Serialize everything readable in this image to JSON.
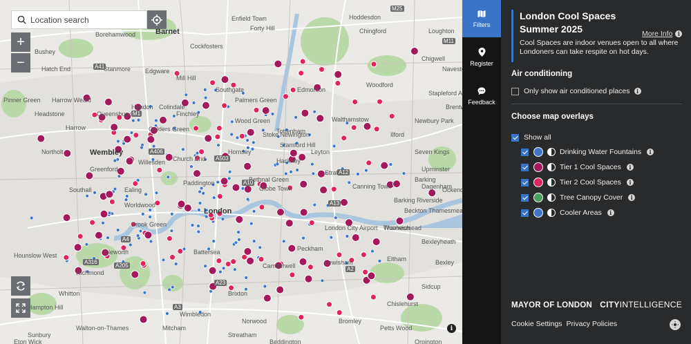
{
  "search": {
    "placeholder": "Location search"
  },
  "zoom": {
    "in": "+",
    "out": "−"
  },
  "map_labels": [
    {
      "text": "Bushey"
    },
    {
      "text": "Borehamwood"
    },
    {
      "text": "Barnet"
    },
    {
      "text": "Enfield Town"
    },
    {
      "text": "Forty Hill"
    },
    {
      "text": "Cockfosters"
    },
    {
      "text": "Chingford"
    },
    {
      "text": "Loughton"
    },
    {
      "text": "Hatch End"
    },
    {
      "text": "Stanmore"
    },
    {
      "text": "Edgware"
    },
    {
      "text": "Mill Hill"
    },
    {
      "text": "Southgate"
    },
    {
      "text": "Palmers Green"
    },
    {
      "text": "Edmonton"
    },
    {
      "text": "Woodford"
    },
    {
      "text": "Chigwell"
    },
    {
      "text": "Pinner Green"
    },
    {
      "text": "Harrow Weald"
    },
    {
      "text": "Colindale"
    },
    {
      "text": "Finchley"
    },
    {
      "text": "Wood Green"
    },
    {
      "text": "Tottenham"
    },
    {
      "text": "Walthamstow"
    },
    {
      "text": "Ilford"
    },
    {
      "text": "Newbury Park"
    },
    {
      "text": "Headstone"
    },
    {
      "text": "Harrow"
    },
    {
      "text": "Queensbury"
    },
    {
      "text": "Hendon"
    },
    {
      "text": "Hornsey"
    },
    {
      "text": "Stamford Hill"
    },
    {
      "text": "Leyton"
    },
    {
      "text": "Seven Kings"
    },
    {
      "text": "Northolt"
    },
    {
      "text": "Wembley"
    },
    {
      "text": "Golders Green"
    },
    {
      "text": "Dagenham"
    },
    {
      "text": "Stratford"
    },
    {
      "text": "Barking"
    },
    {
      "text": "Greenford"
    },
    {
      "text": "Willesden"
    },
    {
      "text": "Hackney"
    },
    {
      "text": "Church End"
    },
    {
      "text": "Ealing"
    },
    {
      "text": "Southall"
    },
    {
      "text": "Paddington"
    },
    {
      "text": "Globe Town"
    },
    {
      "text": "Canning Town"
    },
    {
      "text": "Beckton"
    },
    {
      "text": "Bethnal Green"
    },
    {
      "text": "Worldwood"
    },
    {
      "text": "London"
    },
    {
      "text": "Brook Green"
    },
    {
      "text": "Barking Riverside"
    },
    {
      "text": "Isleworth"
    },
    {
      "text": "Hounslow West"
    },
    {
      "text": "Battersea"
    },
    {
      "text": "Camberwell"
    },
    {
      "text": "Peckham"
    },
    {
      "text": "Woolwich"
    },
    {
      "text": "Thamesmead"
    },
    {
      "text": "Brixton"
    },
    {
      "text": "Eltham"
    },
    {
      "text": "Lewisham"
    },
    {
      "text": "Richmond"
    },
    {
      "text": "Whitton"
    },
    {
      "text": "Hampton Hill"
    },
    {
      "text": "Bexleyheath"
    },
    {
      "text": "Wimbledon"
    },
    {
      "text": "Sidcup"
    },
    {
      "text": "Chislehurst"
    },
    {
      "text": "Norwood"
    },
    {
      "text": "Streatham"
    },
    {
      "text": "Mitcham"
    },
    {
      "text": "Sunbury"
    },
    {
      "text": "Walton-on-Thames"
    },
    {
      "text": "Beddington"
    },
    {
      "text": "Bromley"
    },
    {
      "text": "Petts Wood"
    },
    {
      "text": "Orpington"
    },
    {
      "text": "Navestock"
    },
    {
      "text": "Stapleford Abbotts"
    },
    {
      "text": "Brentwood"
    },
    {
      "text": "Ockendon"
    },
    {
      "text": "Upminster"
    },
    {
      "text": "London City Airport"
    },
    {
      "text": "Thamesmead"
    },
    {
      "text": "Eton Wick"
    },
    {
      "text": "Bexley"
    },
    {
      "text": "Hoddesdon"
    },
    {
      "text": "Stoke Newington"
    }
  ],
  "road_shields": [
    "M25",
    "A41",
    "M1",
    "A406",
    "A503",
    "A10",
    "A12",
    "A13",
    "A4",
    "A316",
    "A205",
    "A23",
    "A3",
    "M11",
    "A2"
  ],
  "nav": {
    "filters": "Filters",
    "register": "Register",
    "feedback": "Feedback"
  },
  "panel": {
    "title": "London Cool Spaces Summer 2025",
    "more_info": "More Info",
    "description": "Cool Spaces are indoor venues open to all where Londoners can take respite on hot days.",
    "air_heading": "Air conditioning",
    "air_option": "Only show air conditioned places",
    "overlays_heading": "Choose map overlays",
    "show_all": "Show all",
    "overlays": [
      {
        "label": "Drinking Water Fountains",
        "color": "#3b76c9"
      },
      {
        "label": "Tier 1 Cool Spaces",
        "color": "#a3195b"
      },
      {
        "label": "Tier 2 Cool Spaces",
        "color": "#e0245e"
      },
      {
        "label": "Tree Canopy Cover",
        "color": "#4a9e5c"
      },
      {
        "label": "Cooler Areas",
        "color": "#3b76c9"
      }
    ],
    "logo_mayor": "MAYOR OF LONDON",
    "logo_city": "CITY",
    "logo_intel": "INTELLIGENCE",
    "cookie": "Cookie Settings",
    "privacy": "Privacy Policies"
  },
  "colors": {
    "accent": "#3a74c6",
    "tier1": "#a3195b",
    "tier2": "#e0245e",
    "fountain": "#3b76c9",
    "panel": "#292a2c"
  }
}
